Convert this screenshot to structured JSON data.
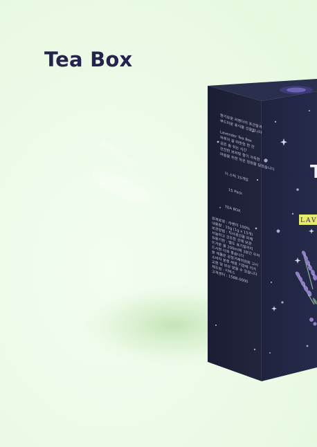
{
  "brand": {
    "title": "Tea Box",
    "title_color": "#24234d"
  },
  "product": {
    "name": "tea-box-package",
    "front_label_text": "LAVE",
    "front_letter": "T",
    "colors": {
      "box_front": "#222640",
      "box_side": "#1d2037",
      "box_top": "#2a2e4c",
      "label_yellow": "#e8ea6a",
      "lavender": "#8f7fc6",
      "stem": "#8ba894"
    }
  },
  "side_panel": {
    "intro_lines": [
      "향기로운 라벤더의 포근함과",
      "부드러운 휴식을 선물합니다",
      "",
      "Lavender Tea Box",
      "하루의 끝 따뜻한 한 잔",
      "깊은 숨 쉬는 시간",
      "잔잔한 보라빛 향기 가득한",
      "마음을 위한 작은 정원을 담았습니다"
    ],
    "mid_line_1": "티 스틱 15개입",
    "mid_line_2": "15 Pack",
    "brand_line": "TEA BOX",
    "info_lines": [
      "원재료명 : 라벤더 100%",
      "내용량 : 15g (1g x 15개)",
      "보관방법 : 직사광선을 피해",
      "서늘하고 건조한 곳에 보관",
      "유통기한 : 별도 표기일까지",
      "뜨거운 물 200ml에 3분간 우려",
      "드시면 더욱 좋습니다",
      "본 제품은 공정거래위원회 고시",
      "소비자 분쟁 해결 기준에 의거",
      "교환 및 보상 받을 수 있습니다",
      "제조원 : 티박스",
      "고객센터 : 1588-0000"
    ]
  }
}
